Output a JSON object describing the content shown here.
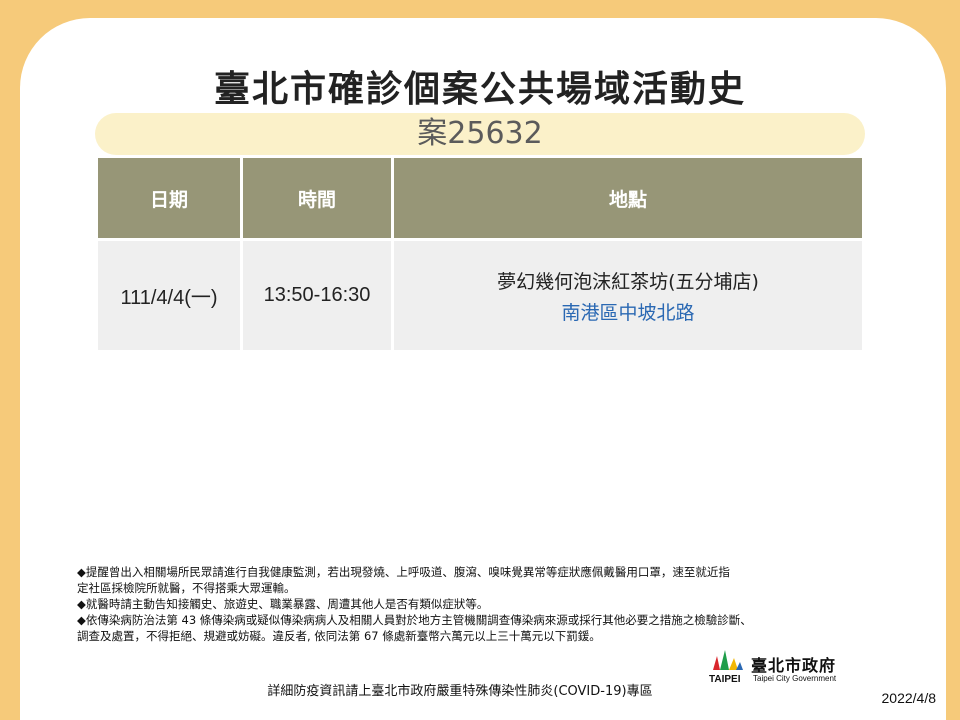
{
  "page": {
    "title": "臺北市確診個案公共場域活動史",
    "case_label": "案25632"
  },
  "table": {
    "headers": {
      "date": "日期",
      "time": "時間",
      "place": "地點"
    },
    "rows": [
      {
        "date": "111/4/4(一)",
        "time": "13:50-16:30",
        "place_name": "夢幻幾何泡沫紅茶坊(五分埔店)",
        "place_address": "南港區中坡北路"
      }
    ]
  },
  "notes": [
    "提醒曾出入相關場所民眾請進行自我健康監測，若出現發燒、上呼吸道、腹瀉、嗅味覺異常等症狀應佩戴醫用口罩，速至就近指\n定社區採檢院所就醫，不得搭乘大眾運輸。",
    "就醫時請主動告知接觸史、旅遊史、職業暴露、周遭其他人是否有類似症狀等。",
    "依傳染病防治法第 43 條傳染病或疑似傳染病病人及相關人員對於地方主管機關調查傳染病來源或採行其他必要之措施之檢驗診斷、\n調查及處置，不得拒絕、規避或妨礙。違反者, 依同法第 67 條處新臺幣六萬元以上三十萬元以下罰鍰。"
  ],
  "note_marker": "◆",
  "footer": {
    "info_text": "詳細防疫資訊請上臺北市政府嚴重特殊傳染性肺炎(COVID-19)專區",
    "logo_chinese": "臺北市政府",
    "logo_latin": "TAIPEI",
    "logo_sub": "Taipei City Government",
    "date": "2022/4/8"
  },
  "colors": {
    "background": "#f6ca7a",
    "header_cell": "#979677",
    "case_bar": "#fbf1c9",
    "body_cell": "#efefef",
    "address": "#2a68b3"
  }
}
